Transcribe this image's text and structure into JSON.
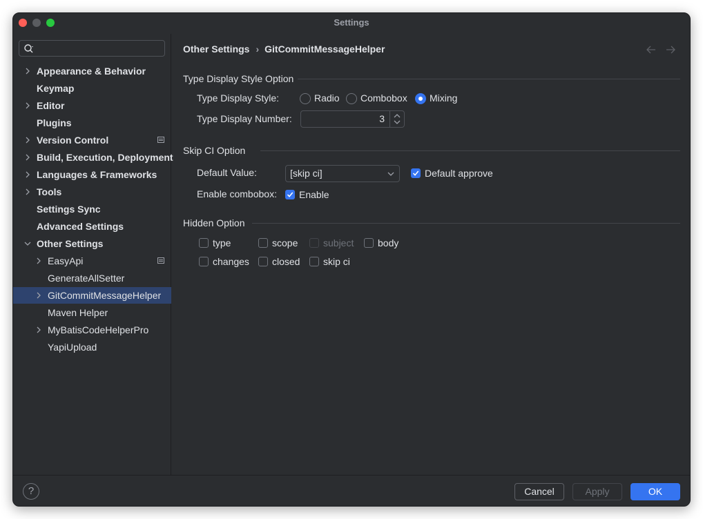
{
  "window": {
    "title": "Settings"
  },
  "sidebar": {
    "search": {
      "placeholder": ""
    },
    "items": [
      {
        "label": "Appearance & Behavior",
        "expandable": true
      },
      {
        "label": "Keymap",
        "expandable": false
      },
      {
        "label": "Editor",
        "expandable": true
      },
      {
        "label": "Plugins",
        "expandable": false
      },
      {
        "label": "Version Control",
        "expandable": true,
        "badge": "module-icon"
      },
      {
        "label": "Build, Execution, Deployment",
        "expandable": true
      },
      {
        "label": "Languages & Frameworks",
        "expandable": true
      },
      {
        "label": "Tools",
        "expandable": true
      },
      {
        "label": "Settings Sync",
        "expandable": false
      },
      {
        "label": "Advanced Settings",
        "expandable": false
      },
      {
        "label": "Other Settings",
        "expandable": true,
        "expanded": true
      },
      {
        "label": "EasyApi",
        "expandable": true,
        "badge": "module-icon"
      },
      {
        "label": "GenerateAllSetter",
        "expandable": false
      },
      {
        "label": "GitCommitMessageHelper",
        "expandable": true,
        "selected": true
      },
      {
        "label": "Maven Helper",
        "expandable": false
      },
      {
        "label": "MyBatisCodeHelperPro",
        "expandable": true
      },
      {
        "label": "YapiUpload",
        "expandable": false
      }
    ]
  },
  "breadcrumb": {
    "parent": "Other Settings",
    "current": "GitCommitMessageHelper"
  },
  "type_display": {
    "section_title": "Type Display Style Option",
    "style_label": "Type Display Style:",
    "options": [
      "Radio",
      "Combobox",
      "Mixing"
    ],
    "selected": "Mixing",
    "number_label": "Type Display Number:",
    "number_value": "3"
  },
  "skip_ci": {
    "section_title": "Skip CI Option",
    "default_label": "Default Value:",
    "default_value": "[skip ci]",
    "approve_label": "Default approve",
    "approve_checked": true,
    "enable_combobox_label": "Enable combobox:",
    "enable_label": "Enable",
    "enable_checked": true
  },
  "hidden": {
    "section_title": "Hidden Option",
    "row1": [
      {
        "label": "type",
        "checked": false,
        "disabled": false
      },
      {
        "label": "scope",
        "checked": false,
        "disabled": false
      },
      {
        "label": "subject",
        "checked": false,
        "disabled": true
      },
      {
        "label": "body",
        "checked": false,
        "disabled": false
      }
    ],
    "row2": [
      {
        "label": "changes",
        "checked": false,
        "disabled": false
      },
      {
        "label": "closed",
        "checked": false,
        "disabled": false
      },
      {
        "label": "skip ci",
        "checked": false,
        "disabled": false
      }
    ]
  },
  "footer": {
    "help_label": "?",
    "cancel_label": "Cancel",
    "apply_label": "Apply",
    "ok_label": "OK"
  },
  "colors": {
    "background": "#2b2d30",
    "accent": "#3574f0",
    "selection": "#2e436e"
  }
}
